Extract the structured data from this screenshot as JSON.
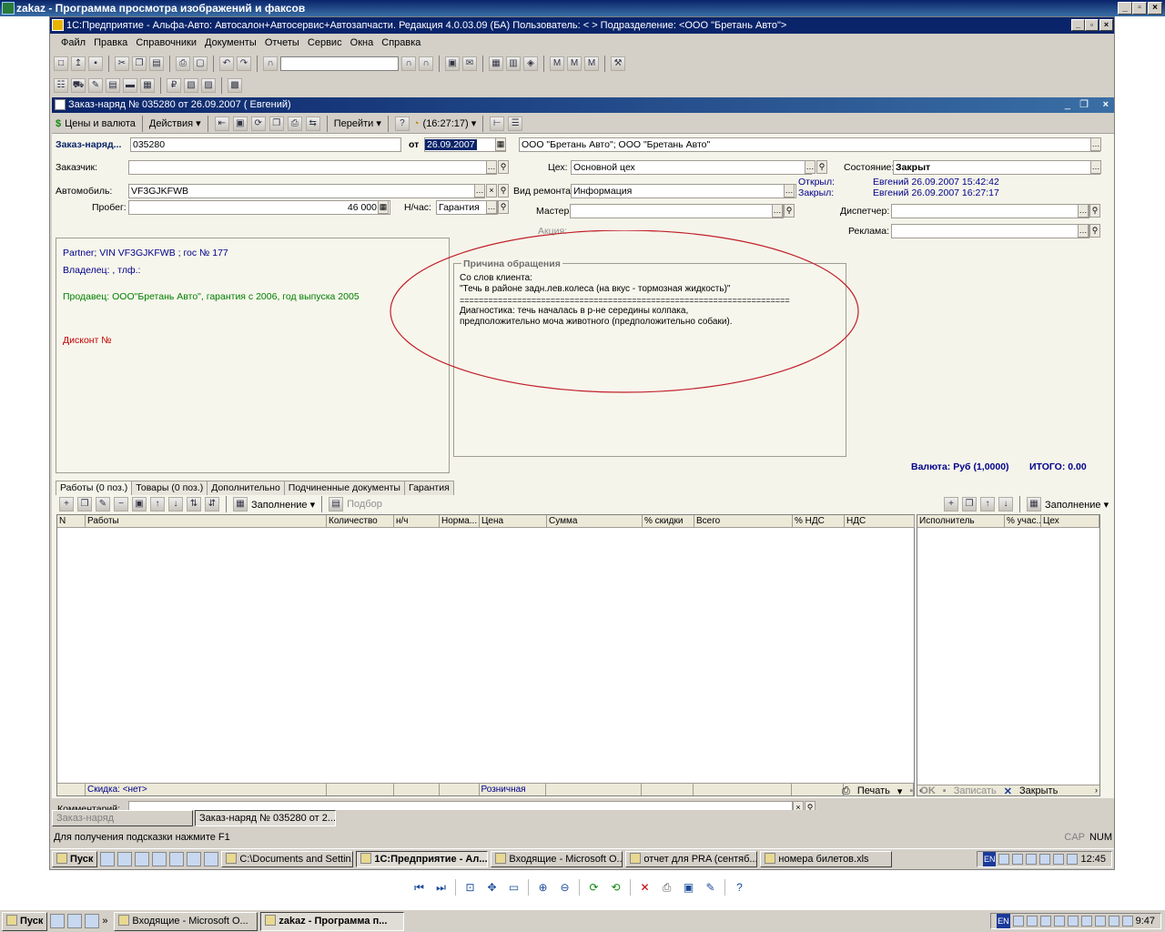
{
  "window": {
    "title": "zakaz - Программа просмотра изображений и факсов"
  },
  "app": {
    "title": "1С:Предприятие - Альфа-Авто: Автосалон+Автосервис+Автозапчасти. Редакция 4.0.03.09 (БА)   Пользователь: <                         >   Подразделение: <ООО \"Бретань Авто\">"
  },
  "menu": [
    "Файл",
    "Правка",
    "Справочники",
    "Документы",
    "Отчеты",
    "Сервис",
    "Окна",
    "Справка"
  ],
  "doc": {
    "title": "Заказ-наряд № 035280 от 26.09.2007 (                Евгений)",
    "toolbar": {
      "prices": "Цены и валюта",
      "actions": "Действия ▾",
      "goto": "Перейти ▾",
      "time": "(16:27:17) ▾"
    }
  },
  "form": {
    "order_label": "Заказ-наряд...",
    "order_no": "035280",
    "from_label": "от",
    "date": "26.09.2007",
    "org": "ООО \"Бретань Авто\"; ООО \"Бретань Авто\"",
    "customer_label": "Заказчик:",
    "customer": "",
    "shop_label": "Цех:",
    "shop": "Основной цех",
    "state_label": "Состояние:",
    "state": "Закрыт",
    "car_label": "Автомобиль:",
    "car": "VF3GJKFWB",
    "repair_label": "Вид ремонта:",
    "repair": "Информация",
    "opened_label": "Открыл:",
    "opened": "Евгений 26.09.2007 15:42:42",
    "closed_label": "Закрыл:",
    "closed": "Евгений 26.09.2007 16:27:17",
    "mileage_label": "Пробег:",
    "mileage": "46 000",
    "rate_label": "Н/час:",
    "rate": "Гарантия",
    "master_label": "Мастер:",
    "master": "",
    "dispatcher_label": "Диспетчер:",
    "dispatcher": "",
    "action_label": "Акция:",
    "ad_label": "Реклама:",
    "ad": "",
    "info": {
      "partner": "Partner; VIN VF3GJKFWB              ; гос №            177",
      "owner": "Владелец:                                              , тлф.:",
      "seller": "Продавец: ООО\"Бретань Авто\", гарантия с            2006, год выпуска 2005",
      "discount": "Дисконт №"
    },
    "reason": {
      "title": "Причина обращения",
      "line1": "Со слов клиента:",
      "line2": "\"Течь в районе задн.лев.колеса (на вкус - тормозная жидкость)\"",
      "line3": "=====================================================================",
      "line4": "Диагностика: течь началась в р-не середины колпака,",
      "line5": "предположительно моча животного (предположительно собаки)."
    },
    "currency": "Валюта: Руб (1,0000)",
    "total": "ИТОГО: 0.00"
  },
  "tabs": [
    "Работы (0 поз.)",
    "Товары (0 поз.)",
    "Дополнительно",
    "Подчиненные документы",
    "Гарантия"
  ],
  "works_toolbar": {
    "fill": "Заполнение ▾",
    "select": "Подбор"
  },
  "right_toolbar": {
    "fill": "Заполнение ▾"
  },
  "works_grid": {
    "columns": [
      "N",
      "Работы",
      "Количество",
      "н/ч",
      "Норма...",
      "Цена",
      "Сумма",
      "% скидки",
      "Всего",
      "% НДС",
      "НДС"
    ],
    "footer": [
      "",
      "Скидка: <нет>",
      "",
      "",
      "",
      "Розничная",
      "",
      "",
      "",
      "",
      ""
    ]
  },
  "exec_grid": {
    "columns": [
      "Исполнитель",
      "% учас...",
      "Цех"
    ]
  },
  "bottom": {
    "comment_label": "Комментарий:",
    "print": "Печать",
    "ok": "OK",
    "save": "Записать",
    "close": "Закрыть"
  },
  "inner_tabs": [
    "Заказ-наряд",
    "Заказ-наряд № 035280 от 2..."
  ],
  "status": {
    "hint": "Для получения подсказки нажмите F1",
    "cap": "CAP",
    "num": "NUM"
  },
  "inner_taskbar": {
    "start": "Пуск",
    "tasks": [
      "C:\\Documents and Settin...",
      "1С:Предприятие - Ал...",
      "Входящие - Microsoft O...",
      "отчет для PRA (сентяб...",
      "номера билетов.xls"
    ],
    "lang": "EN",
    "clock": "12:45"
  },
  "outer_taskbar": {
    "start": "Пуск",
    "tasks": [
      "Входящие - Microsoft O...",
      "zakaz - Программа п..."
    ],
    "lang": "EN",
    "clock": "9:47"
  },
  "colors": {
    "title_blue": "#0a246a",
    "seller_green": "#008000",
    "discount_red": "#c00000",
    "highlight_ellipse": "#c0202a",
    "status_blue": "#00008b"
  }
}
